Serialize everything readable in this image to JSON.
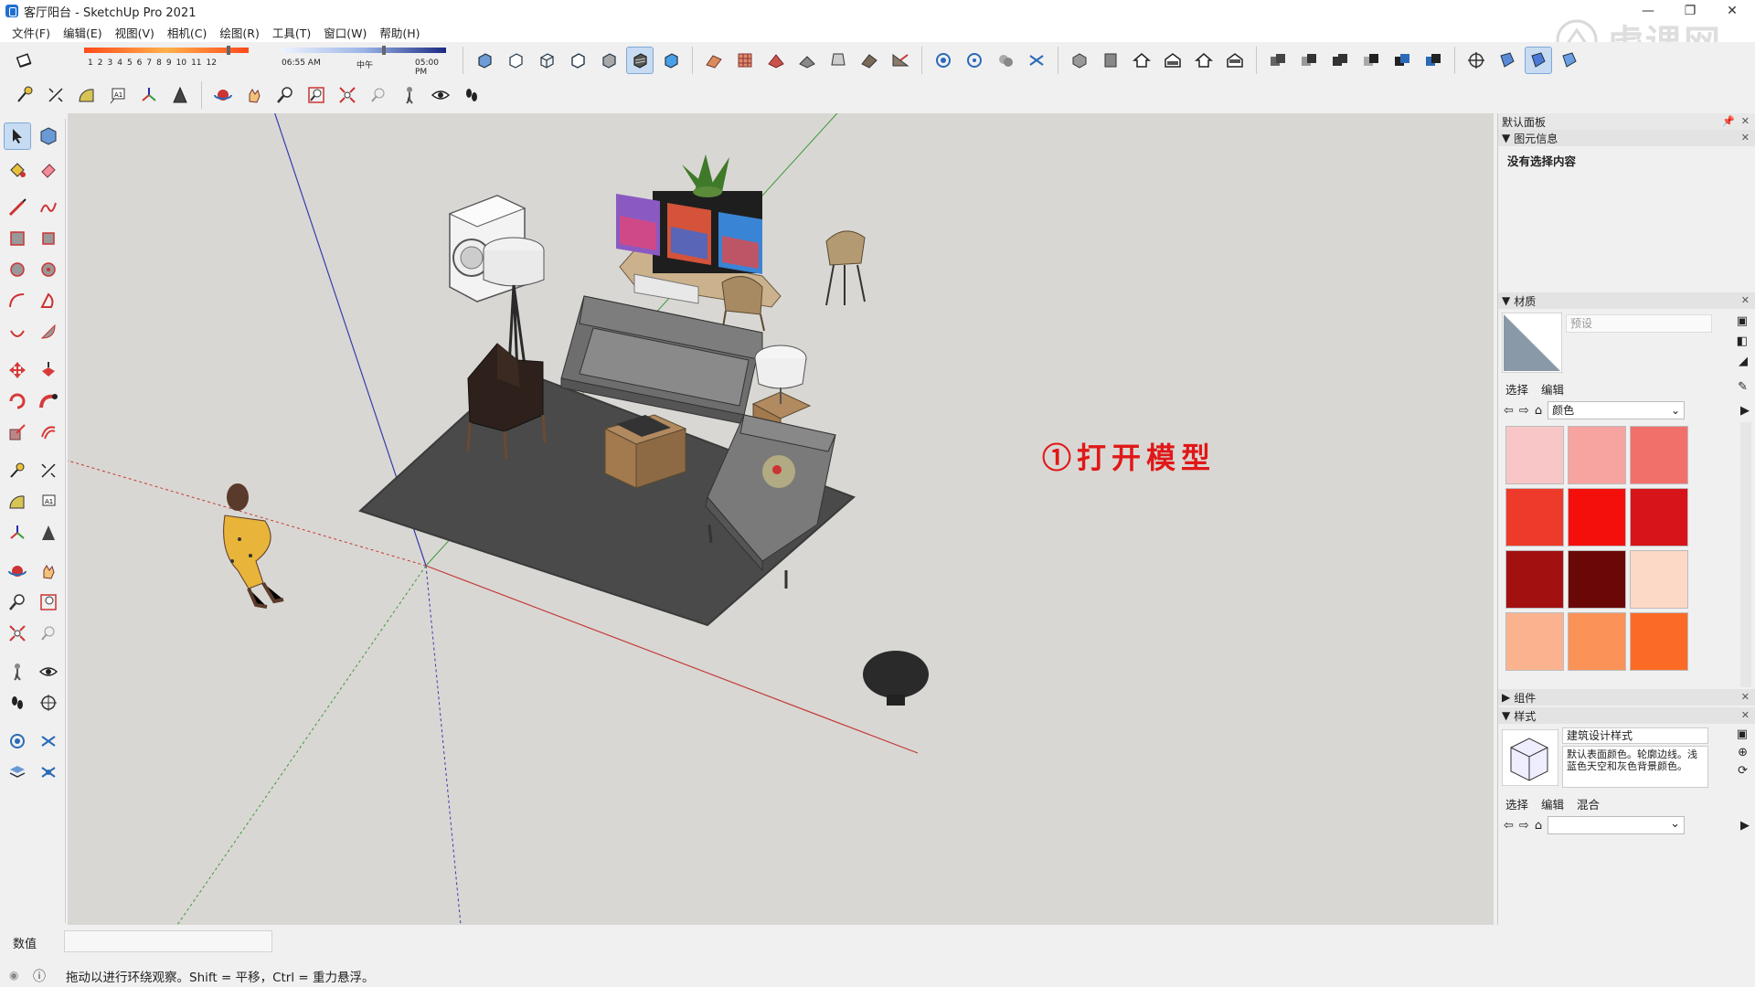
{
  "window": {
    "title": "客厅阳台 - SketchUp Pro 2021",
    "controls": {
      "minimize": "—",
      "maximize": "❐",
      "close": "✕"
    }
  },
  "menu": [
    "文件(F)",
    "编辑(E)",
    "视图(V)",
    "相机(C)",
    "绘图(R)",
    "工具(T)",
    "窗口(W)",
    "帮助(H)"
  ],
  "shadow": {
    "months": [
      "1",
      "2",
      "3",
      "4",
      "5",
      "6",
      "7",
      "8",
      "9",
      "10",
      "11",
      "12"
    ],
    "time_start": "06:55 AM",
    "time_mid": "中午",
    "time_end": "05:00 PM"
  },
  "watermark": "虎课网",
  "annotation": "①打开模型",
  "panel": {
    "title": "默认面板",
    "entity_info": {
      "header": "图元信息",
      "content": "没有选择内容"
    },
    "materials": {
      "header": "材质",
      "preset_placeholder": "预设",
      "tabs": [
        "选择",
        "编辑"
      ],
      "library": "颜色",
      "swatches": [
        "#f8c6c6",
        "#f7a3a0",
        "#f2706a",
        "#ee3a2a",
        "#f50f0b",
        "#d6141a",
        "#a31010",
        "#6a0808",
        "#fcd8c6",
        "#fbb38f",
        "#fb9257",
        "#fb6b26"
      ]
    },
    "components": {
      "header": "组件"
    },
    "styles": {
      "header": "样式",
      "name": "建筑设计样式",
      "description": "默认表面颜色。轮廓边线。浅蓝色天空和灰色背景颜色。",
      "tabs": [
        "选择",
        "编辑",
        "混合"
      ]
    }
  },
  "status": {
    "measurements_label": "数值",
    "hint": "拖动以进行环绕观察。Shift = 平移，Ctrl = 重力悬浮。"
  },
  "colors": {
    "viewport_bg": "#d9d7d3",
    "axis_red": "#c23a3a",
    "axis_green": "#3a9a3a",
    "axis_blue": "#3a3ab0",
    "annotation": "#e01818"
  }
}
